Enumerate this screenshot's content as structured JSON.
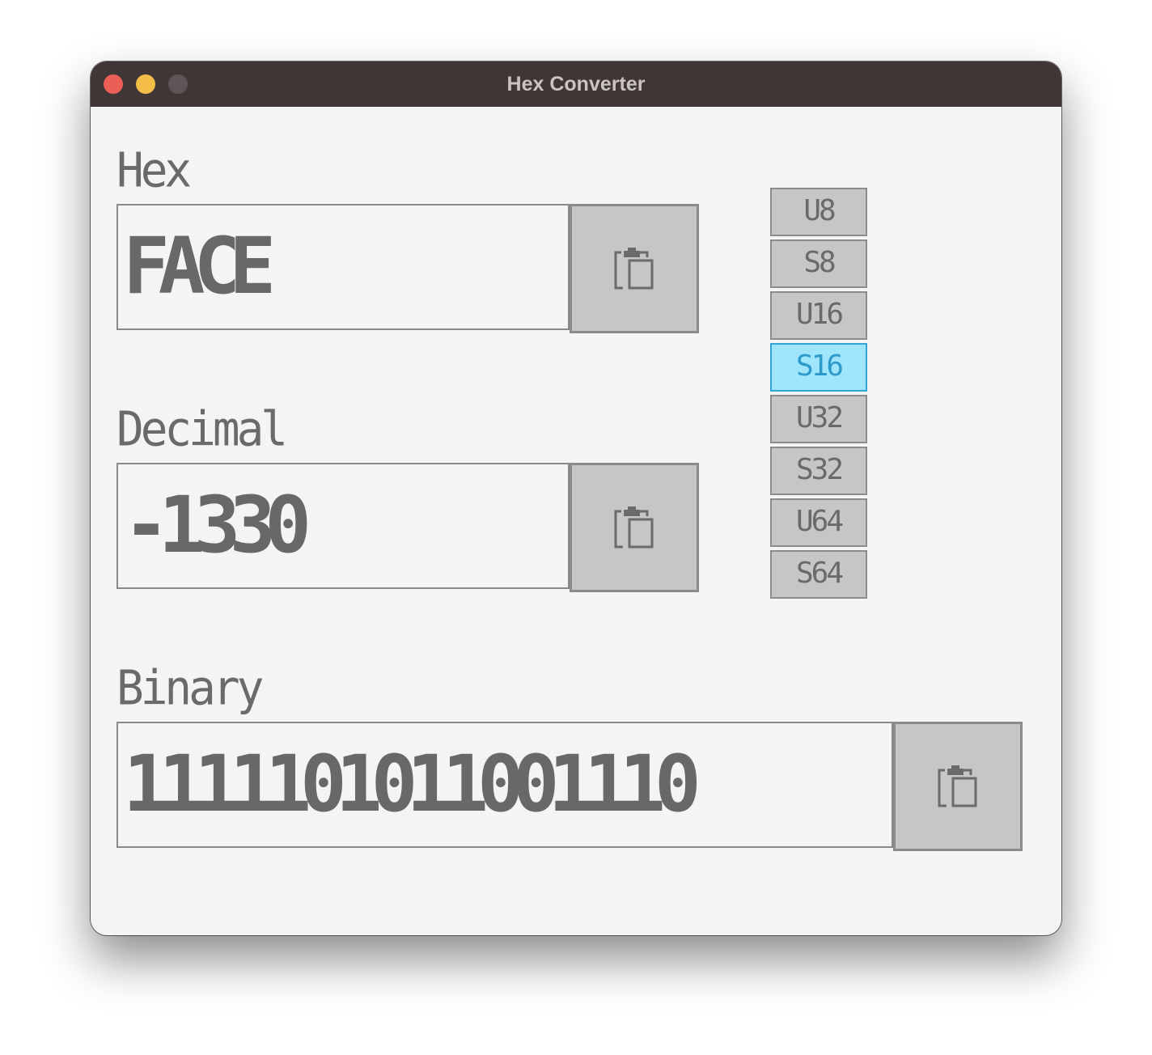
{
  "window": {
    "title": "Hex Converter"
  },
  "fields": {
    "hex": {
      "label": "Hex",
      "value": "FACE"
    },
    "decimal": {
      "label": "Decimal",
      "value": "-1330"
    },
    "binary": {
      "label": "Binary",
      "value": "1111101011001110"
    }
  },
  "types": {
    "selected": "S16",
    "items": [
      "U8",
      "S8",
      "U16",
      "S16",
      "U32",
      "S32",
      "U64",
      "S64"
    ]
  },
  "icons": {
    "copy": "clipboard-icon"
  },
  "colors": {
    "titlebar": "#403636",
    "selected_bg": "#9fe5fb",
    "selected_border": "#32a6d8",
    "selected_text": "#2d9ccd",
    "button_bg": "#c6c6c6",
    "text": "#6a6a6a"
  }
}
